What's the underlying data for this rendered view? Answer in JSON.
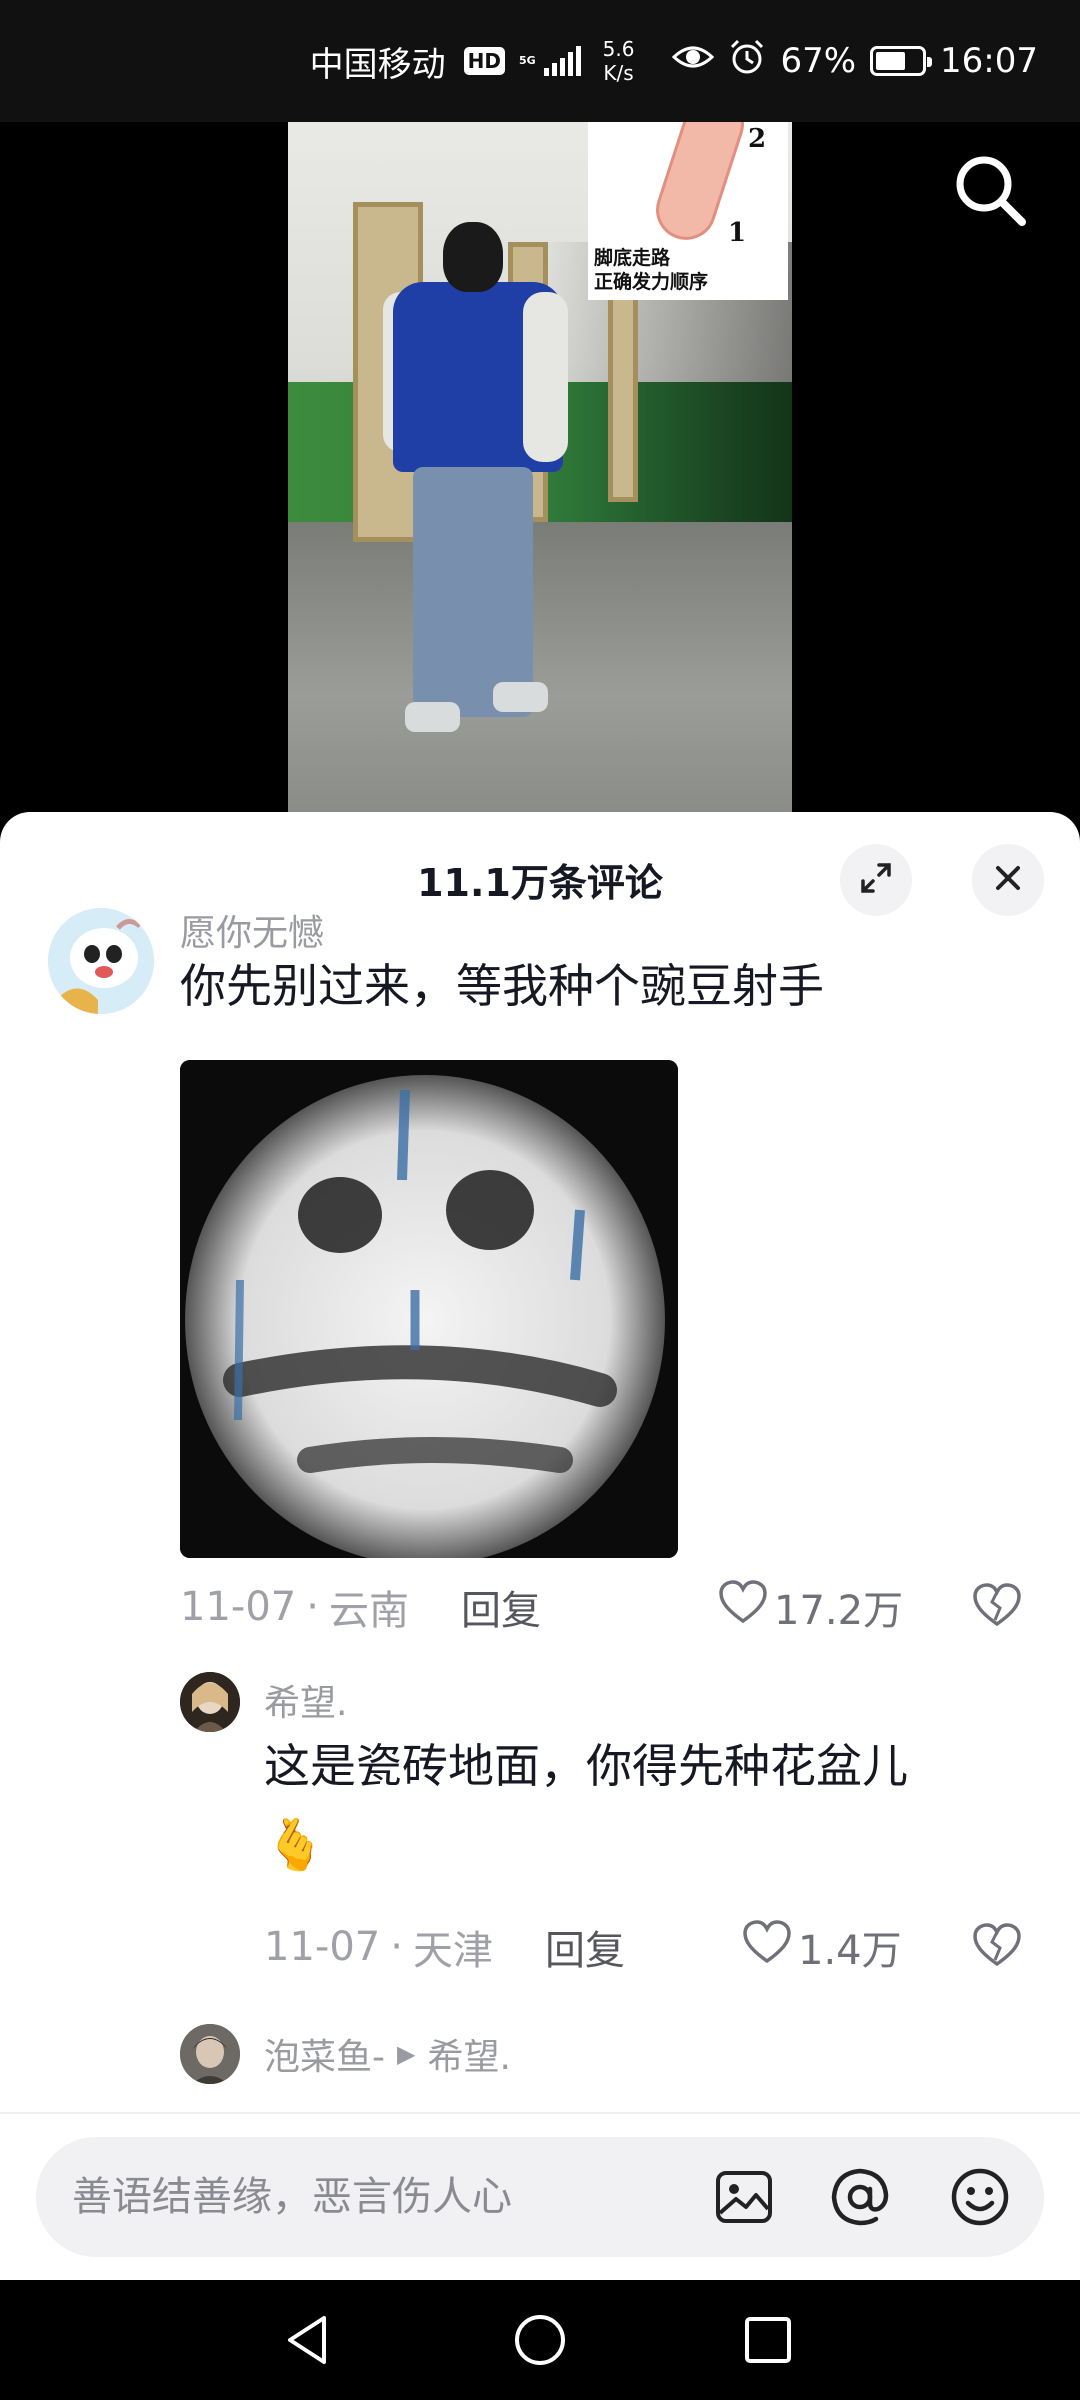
{
  "status_bar": {
    "carrier": "中国移动",
    "hd_badge": "HD",
    "net_type": "5G",
    "speed_value": "5.6",
    "speed_unit": "K/s",
    "battery": "67%",
    "battery_level": 0.67,
    "time": "16:07"
  },
  "video": {
    "inset_caption_line1": "脚底走路",
    "inset_caption_line2": "正确发力顺序",
    "inset_num_1": "1",
    "inset_num_2": "2",
    "search_icon": "search-icon"
  },
  "comments_sheet": {
    "title": "11.1万条评论",
    "expand_icon": "expand-icon",
    "close_icon": "close-icon",
    "comments": [
      {
        "username": "愿你无憾",
        "text": "你先别过来，等我种个豌豆射手",
        "has_image": true,
        "date": "11-07",
        "location": "云南",
        "reply_label": "回复",
        "likes": "17.2万"
      }
    ],
    "replies": [
      {
        "username": "希望.",
        "text": "这是瓷砖地面，你得先种花盆儿",
        "emoji": "🫰",
        "date": "11-07",
        "location": "天津",
        "reply_label": "回复",
        "likes": "1.4万"
      },
      {
        "username": "泡菜鱼-",
        "arrow": "▶",
        "reply_to": "希望."
      }
    ],
    "input_placeholder": "善语结善缘，恶言伤人心"
  },
  "nav_bar": {
    "back_icon": "back-triangle-icon",
    "home_icon": "home-circle-icon",
    "recents_icon": "recents-square-icon"
  },
  "colors": {
    "accent_text": "#161823",
    "muted_text": "#9a9ba1",
    "sheet_bg": "#ffffff",
    "input_bg": "#f1f1f3"
  }
}
